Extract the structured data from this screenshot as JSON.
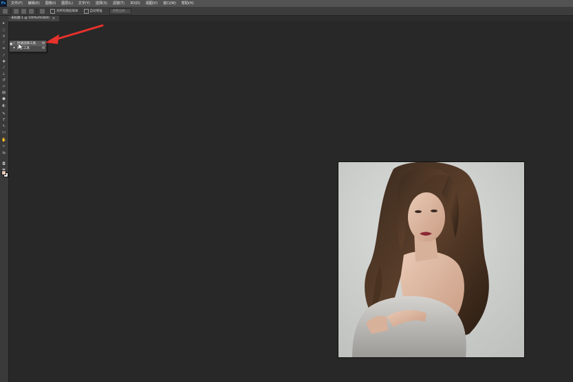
{
  "app": {
    "logo": "Ps"
  },
  "menu": {
    "items": [
      "文件(F)",
      "编辑(E)",
      "图像(I)",
      "图层(L)",
      "文字(Y)",
      "选择(S)",
      "滤镜(T)",
      "3D(D)",
      "视图(V)",
      "窗口(W)",
      "帮助(H)"
    ]
  },
  "options": {
    "sample_all_layers": "对所有图层取样",
    "auto_enhance": "自动增强",
    "refine_edge": "调整边缘..."
  },
  "document": {
    "tab_label": "未标题-1 @ 100%(RGB/8)",
    "tab_close": "×"
  },
  "tools": {
    "icons": [
      "move-icon",
      "marquee-icon",
      "lasso-icon",
      "quick-selection-icon",
      "crop-icon",
      "eyedropper-icon",
      "healing-brush-icon",
      "brush-icon",
      "clone-stamp-icon",
      "history-brush-icon",
      "eraser-icon",
      "gradient-icon",
      "blur-icon",
      "dodge-icon",
      "pen-icon",
      "type-icon",
      "path-selection-icon",
      "rectangle-icon",
      "hand-icon",
      "zoom-icon"
    ],
    "foreground_color": "#e3c7b8",
    "background_color": "#ffffff"
  },
  "flyout": {
    "items": [
      {
        "label": "快速选择工具",
        "shortcut": "W",
        "selected": true,
        "icon": "quick-selection-icon"
      },
      {
        "label": "魔棒工具",
        "shortcut": "W",
        "selected": false,
        "icon": "magic-wand-icon"
      }
    ]
  },
  "colors": {
    "annotation_arrow": "#e8312c"
  }
}
